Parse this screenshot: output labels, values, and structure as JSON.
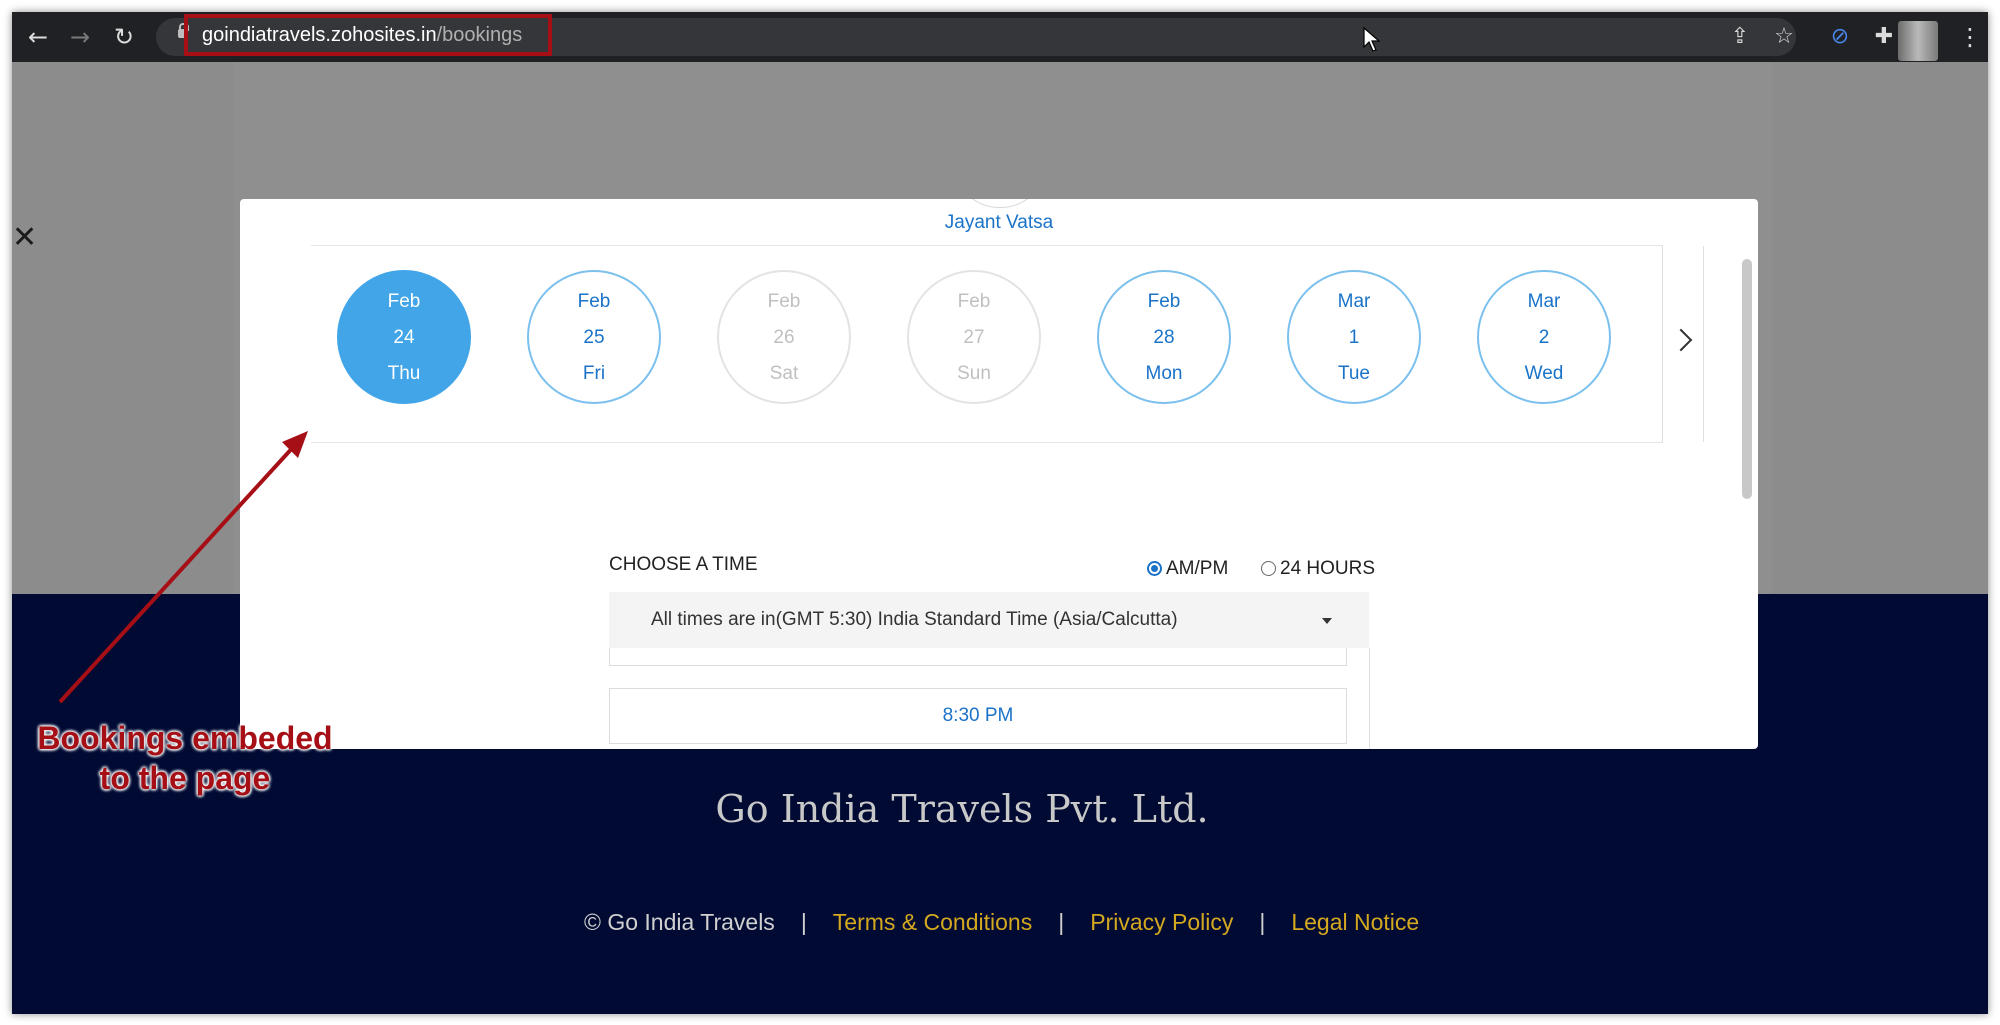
{
  "browser": {
    "url_host": "goindiatravels.zohosites.in",
    "url_path": "/bookings",
    "icons": [
      "back-icon",
      "forward-icon",
      "reload-icon",
      "lock-icon",
      "share-icon",
      "star-icon",
      "link-icon",
      "extensions-icon",
      "menu-icon"
    ]
  },
  "modal": {
    "staff_name": "Jayant Vatsa",
    "dates": [
      {
        "month": "Feb",
        "day": "24",
        "weekday": "Thu",
        "state": "selected"
      },
      {
        "month": "Feb",
        "day": "25",
        "weekday": "Fri",
        "state": "available"
      },
      {
        "month": "Feb",
        "day": "26",
        "weekday": "Sat",
        "state": "unavailable"
      },
      {
        "month": "Feb",
        "day": "27",
        "weekday": "Sun",
        "state": "unavailable"
      },
      {
        "month": "Feb",
        "day": "28",
        "weekday": "Mon",
        "state": "available"
      },
      {
        "month": "Mar",
        "day": "1",
        "weekday": "Tue",
        "state": "available"
      },
      {
        "month": "Mar",
        "day": "2",
        "weekday": "Wed",
        "state": "available"
      }
    ],
    "choose_time_label": "CHOOSE A TIME",
    "format_options": [
      {
        "label": "AM/PM",
        "selected": true
      },
      {
        "label": "24 HOURS",
        "selected": false
      }
    ],
    "timezone_text": "All times are in(GMT 5:30) India Standard Time (Asia/Calcutta)",
    "time_slots": [
      "8:30 PM"
    ]
  },
  "footer": {
    "company_name": "Go India Travels Pvt. Ltd.",
    "copyright": "© Go India Travels",
    "separator": "|",
    "links": [
      "Terms & Conditions",
      "Privacy Policy",
      "Legal Notice"
    ]
  },
  "annotation": {
    "line1": "Bookings embeded",
    "line2": "to the page"
  },
  "colors": {
    "accent_blue": "#1a73c9",
    "selected_date": "#41a5e8",
    "footer_bg": "#000a33",
    "footer_link": "#d4a81f",
    "annotation": "#a50f15"
  }
}
